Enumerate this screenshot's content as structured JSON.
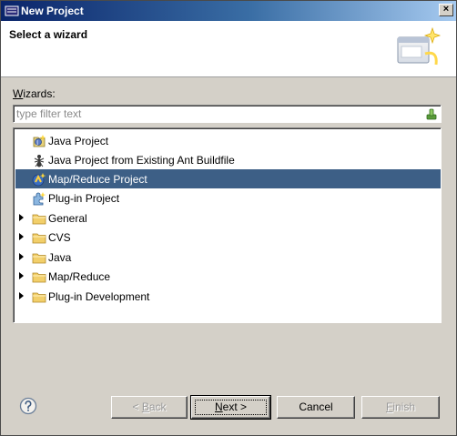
{
  "window": {
    "title": "New Project",
    "close_label": "×"
  },
  "banner": {
    "heading": "Select a wizard"
  },
  "wizards": {
    "label_mnemonic": "W",
    "label_rest": "izards:",
    "filter_placeholder": "type filter text"
  },
  "tree": {
    "items": [
      {
        "label": "Java Project",
        "icon": "java-project-icon",
        "expandable": false,
        "selected": false
      },
      {
        "label": "Java Project from Existing Ant Buildfile",
        "icon": "ant-icon",
        "expandable": false,
        "selected": false
      },
      {
        "label": "Map/Reduce Project",
        "icon": "mapreduce-project-icon",
        "expandable": false,
        "selected": true
      },
      {
        "label": "Plug-in Project",
        "icon": "plugin-project-icon",
        "expandable": false,
        "selected": false
      },
      {
        "label": "General",
        "icon": "folder-icon",
        "expandable": true,
        "selected": false
      },
      {
        "label": "CVS",
        "icon": "folder-icon",
        "expandable": true,
        "selected": false
      },
      {
        "label": "Java",
        "icon": "folder-icon",
        "expandable": true,
        "selected": false
      },
      {
        "label": "Map/Reduce",
        "icon": "folder-icon",
        "expandable": true,
        "selected": false
      },
      {
        "label": "Plug-in Development",
        "icon": "folder-icon",
        "expandable": true,
        "selected": false
      }
    ]
  },
  "buttons": {
    "back_prefix": "< ",
    "back_mnemonic": "B",
    "back_rest": "ack",
    "next_mnemonic": "N",
    "next_rest": "ext >",
    "cancel": "Cancel",
    "finish_mnemonic": "F",
    "finish_rest": "inish"
  },
  "colors": {
    "selection": "#3d5f86",
    "titlebar_start": "#0a246a",
    "dialog_bg": "#d4d0c8"
  }
}
